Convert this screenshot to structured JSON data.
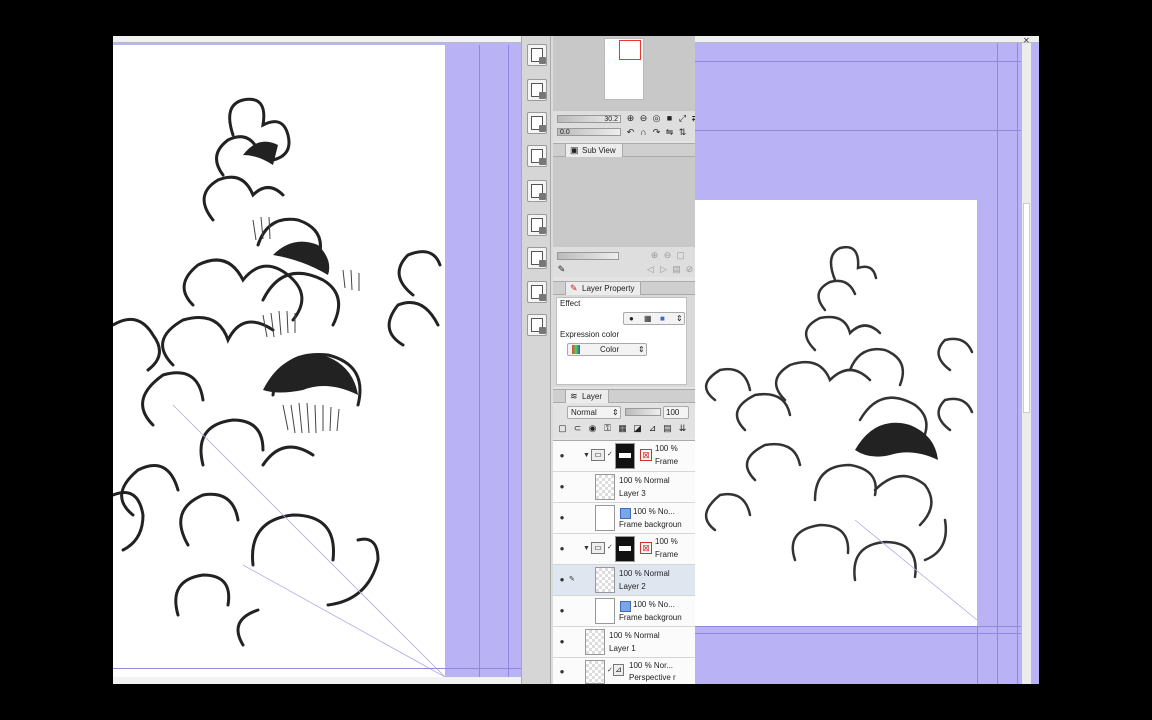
{
  "nav_controls": {
    "zoom_value": "30.2",
    "rotate_value": "0.0"
  },
  "tabs": {
    "sub_view": "Sub View",
    "layer_property": "Layer Property",
    "layer": "Layer"
  },
  "layer_property": {
    "effect_label": "Effect",
    "expression_color_label": "Expression color",
    "expression_color_value": "Color"
  },
  "layer_panel": {
    "blend_mode": "Normal",
    "opacity": "100"
  },
  "layers": [
    {
      "line1": "100 %",
      "line2": "Frame",
      "kind": "folder"
    },
    {
      "line1": "100 % Normal",
      "line2": "Layer 3",
      "kind": "raster"
    },
    {
      "line1": "100 % No...",
      "line2": "Frame backgroun",
      "kind": "paper"
    },
    {
      "line1": "100 %",
      "line2": "Frame",
      "kind": "folder"
    },
    {
      "line1": "100 % Normal",
      "line2": "Layer 2",
      "kind": "raster",
      "selected": true
    },
    {
      "line1": "100 % No...",
      "line2": "Frame backgroun",
      "kind": "paper"
    },
    {
      "line1": "100 % Normal",
      "line2": "Layer 1",
      "kind": "raster"
    },
    {
      "line1": "100 % Nor...",
      "line2": "Perspective r",
      "kind": "ruler"
    }
  ],
  "icons": {
    "eye": "eye-icon",
    "folder": "folder-icon",
    "mask": "mask-icon",
    "pen": "pen-icon"
  },
  "colors": {
    "canvas_background": "#b9b2f5",
    "guide": "#8f87e0",
    "selection": "#dfe6f0"
  }
}
